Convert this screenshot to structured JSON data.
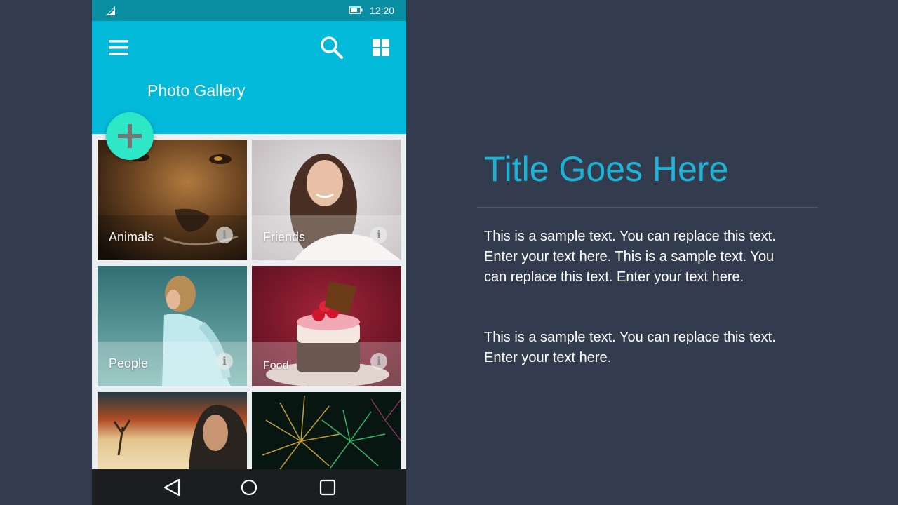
{
  "status_bar": {
    "time": "12:20"
  },
  "app_bar": {
    "title": "Photo Gallery"
  },
  "gallery": {
    "tiles": [
      {
        "label": "Animals"
      },
      {
        "label": "Friends"
      },
      {
        "label": "People"
      },
      {
        "label": "Food"
      },
      {
        "label": ""
      },
      {
        "label": ""
      }
    ]
  },
  "slide": {
    "title": "Title Goes Here",
    "paragraph_1": "This is a sample text. You can replace this text. Enter your text here. This is a sample text. You can replace this text. Enter your text here.",
    "paragraph_2": "This is a sample text. You can replace this text. Enter your text here."
  },
  "colors": {
    "background": "#323c4e",
    "status_bar": "#0a8ea1",
    "app_bar": "#03b9d9",
    "fab": "#2ee7c6",
    "title_accent": "#1eb3d6",
    "nav_bar": "#1c1d1f"
  },
  "icons": {
    "menu": "hamburger-menu-icon",
    "search": "search-icon",
    "view": "tiles-view-icon",
    "add": "plus-icon",
    "info": "info-icon",
    "back": "back-triangle-icon",
    "home": "home-circle-icon",
    "recent": "recent-apps-square-icon"
  }
}
